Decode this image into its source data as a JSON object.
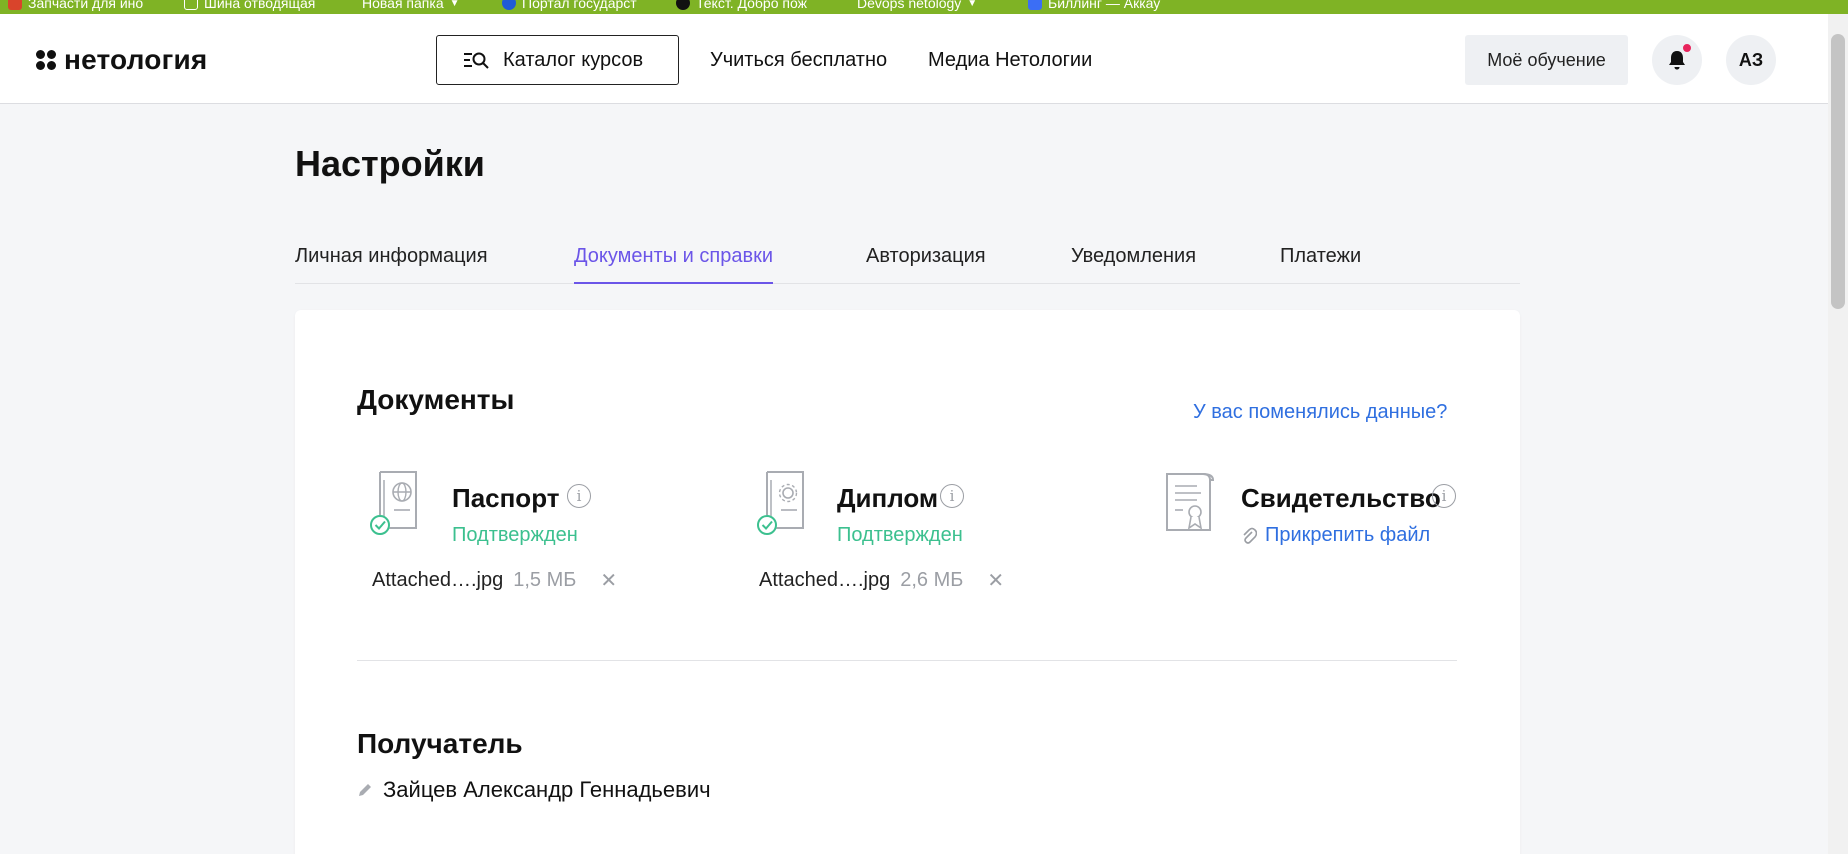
{
  "browser": {
    "bookmarks": [
      {
        "label": "Запчасти для ино",
        "icon": "calendar-icon",
        "color": "#d9442b",
        "dropdown": false
      },
      {
        "label": "Шина отводящая",
        "icon": "page-icon",
        "color": "#ffffff",
        "dropdown": false
      },
      {
        "label": "Новая папка",
        "icon": "folder-icon",
        "color": "#f4c542",
        "dropdown": true
      },
      {
        "label": "Портал государст",
        "icon": "gov-icon",
        "color": "#1f5bd6",
        "dropdown": false
      },
      {
        "label": "Текст. Добро пож",
        "icon": "dots-icon",
        "color": "#111111",
        "dropdown": false
      },
      {
        "label": "Devops netology",
        "icon": "folder-icon",
        "color": "#f4c542",
        "dropdown": true
      },
      {
        "label": "Биллинг — Аккау",
        "icon": "yc-icon",
        "color": "#3b6ef5",
        "dropdown": false
      }
    ]
  },
  "header": {
    "logo_text": "нетология",
    "catalog_label": "Каталог курсов",
    "nav": [
      "Учиться бесплатно",
      "Медиа Нетологии"
    ],
    "my_learning_label": "Моё обучение",
    "avatar_initials": "АЗ",
    "notification_dot_color": "#e8245c"
  },
  "page": {
    "title": "Настройки",
    "tabs": [
      {
        "label": "Личная информация",
        "active": false
      },
      {
        "label": "Документы и справки",
        "active": true
      },
      {
        "label": "Авторизация",
        "active": false
      },
      {
        "label": "Уведомления",
        "active": false
      },
      {
        "label": "Платежи",
        "active": false
      }
    ],
    "accent_color": "#6b55e8"
  },
  "documents": {
    "title": "Документы",
    "changed_link": "У вас поменялись данные?",
    "items": [
      {
        "name": "Паспорт",
        "status": "Подтвержден",
        "file_name": "Attached….jpg",
        "file_size": "1,5 МБ",
        "icon": "passport-icon"
      },
      {
        "name": "Диплом",
        "status": "Подтвержден",
        "file_name": "Attached….jpg",
        "file_size": "2,6 МБ",
        "icon": "diploma-icon"
      },
      {
        "name": "Свидетельство",
        "attach_label": "Прикрепить файл",
        "icon": "certificate-icon"
      }
    ],
    "status_color": "#3cc08f",
    "link_color": "#2f6fe0"
  },
  "recipient": {
    "title": "Получатель",
    "name": "Зайцев Александр Геннадьевич"
  }
}
